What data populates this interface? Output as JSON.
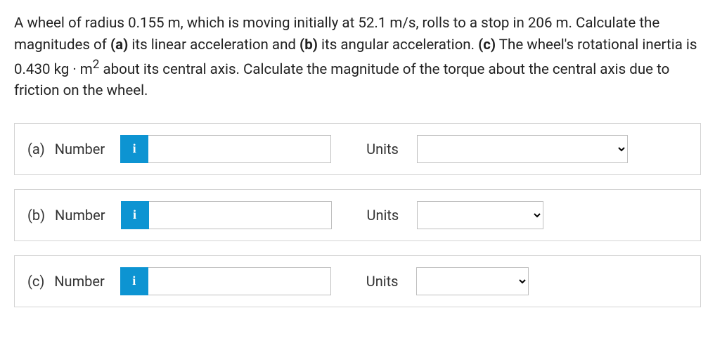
{
  "problem": {
    "text_html": "A wheel of radius 0.155 m, which is moving initially at 52.1 m/s, rolls to a stop in 206 m. Calculate the magnitudes of <b>(a)</b> its linear acceleration and <b>(b)</b> its angular acceleration. <b>(c)</b> The wheel's rotational inertia is 0.430 kg · m<sup>2</sup> about its central axis. Calculate the magnitude of the torque about the central axis due to friction on the wheel."
  },
  "rows": [
    {
      "part": "(a)",
      "number_label": "Number",
      "info_symbol": "i",
      "number_value": "",
      "units_label": "Units",
      "units_value": "",
      "units_width": "w300"
    },
    {
      "part": "(b)",
      "number_label": "Number",
      "info_symbol": "i",
      "number_value": "",
      "units_label": "Units",
      "units_value": "",
      "units_width": "w180"
    },
    {
      "part": "(c)",
      "number_label": "Number",
      "info_symbol": "i",
      "number_value": "",
      "units_label": "Units",
      "units_value": "",
      "units_width": "w160"
    }
  ]
}
